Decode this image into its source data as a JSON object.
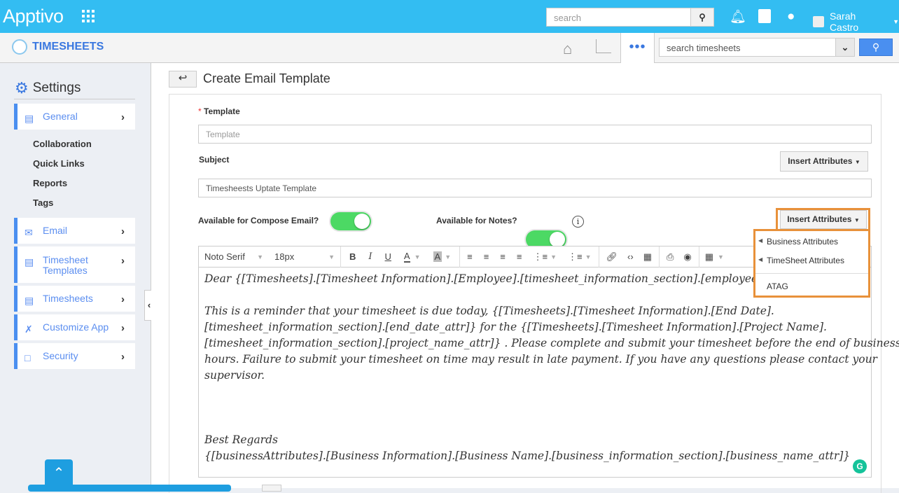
{
  "header": {
    "logo": "Apptivo",
    "search_placeholder": "search",
    "user_name": "Sarah Castro"
  },
  "subheader": {
    "app_title": "TIMESHEETS",
    "more": "•••",
    "search_placeholder": "search timesheets"
  },
  "sidebar": {
    "title": "Settings",
    "items": [
      {
        "label": "General",
        "icon": "monitor-icon"
      },
      {
        "label": "Email",
        "icon": "envelope-icon"
      },
      {
        "label": "Timesheet Templates",
        "icon": "template-icon"
      },
      {
        "label": "Timesheets",
        "icon": "template-icon"
      },
      {
        "label": "Customize App",
        "icon": "tools-icon"
      },
      {
        "label": "Security",
        "icon": "lock-icon"
      }
    ],
    "subitems": [
      "Collaboration",
      "Quick Links",
      "Reports",
      "Tags"
    ]
  },
  "page": {
    "title": "Create Email Template",
    "template_label": "Template",
    "template_placeholder": "Template",
    "subject_label": "Subject",
    "subject_value": "Timesheests Uptate Template",
    "insert_attributes": "Insert Attributes",
    "compose_label": "Available for Compose Email?",
    "compose_on": true,
    "notes_label": "Available for Notes?",
    "notes_on": true
  },
  "editor": {
    "font": "Noto Serif",
    "size": "18px",
    "lines": [
      "Dear {[Timesheets].[Timesheet Information].[Employee].[timesheet_information_section].[employee_name_",
      "",
      "This is a reminder that your timesheet is due today, {[Timesheets].[Timesheet Information].[End Date].",
      "[timesheet_information_section].[end_date_attr]} for the {[Timesheets].[Timesheet Information].[Project Name].",
      "[timesheet_information_section].[project_name_attr]} . Please complete and submit your timesheet before the end of business",
      "hours. Failure to submit your timesheet on time may result in late payment. If you have any questions please contact your",
      "supervisor.",
      "",
      "",
      "",
      "Best Regards",
      "{[businessAttributes].[Business Information].[Business Name].[business_information_section].[business_name_attr]}"
    ]
  },
  "dropdown": {
    "items": [
      "Business Attributes",
      "TimeSheet Attributes"
    ],
    "extra": "ATAG"
  },
  "colors": {
    "topbar": "#33bdf2",
    "accent": "#4a8ff0",
    "highlight": "#e8913a",
    "toggle": "#4cd964"
  }
}
